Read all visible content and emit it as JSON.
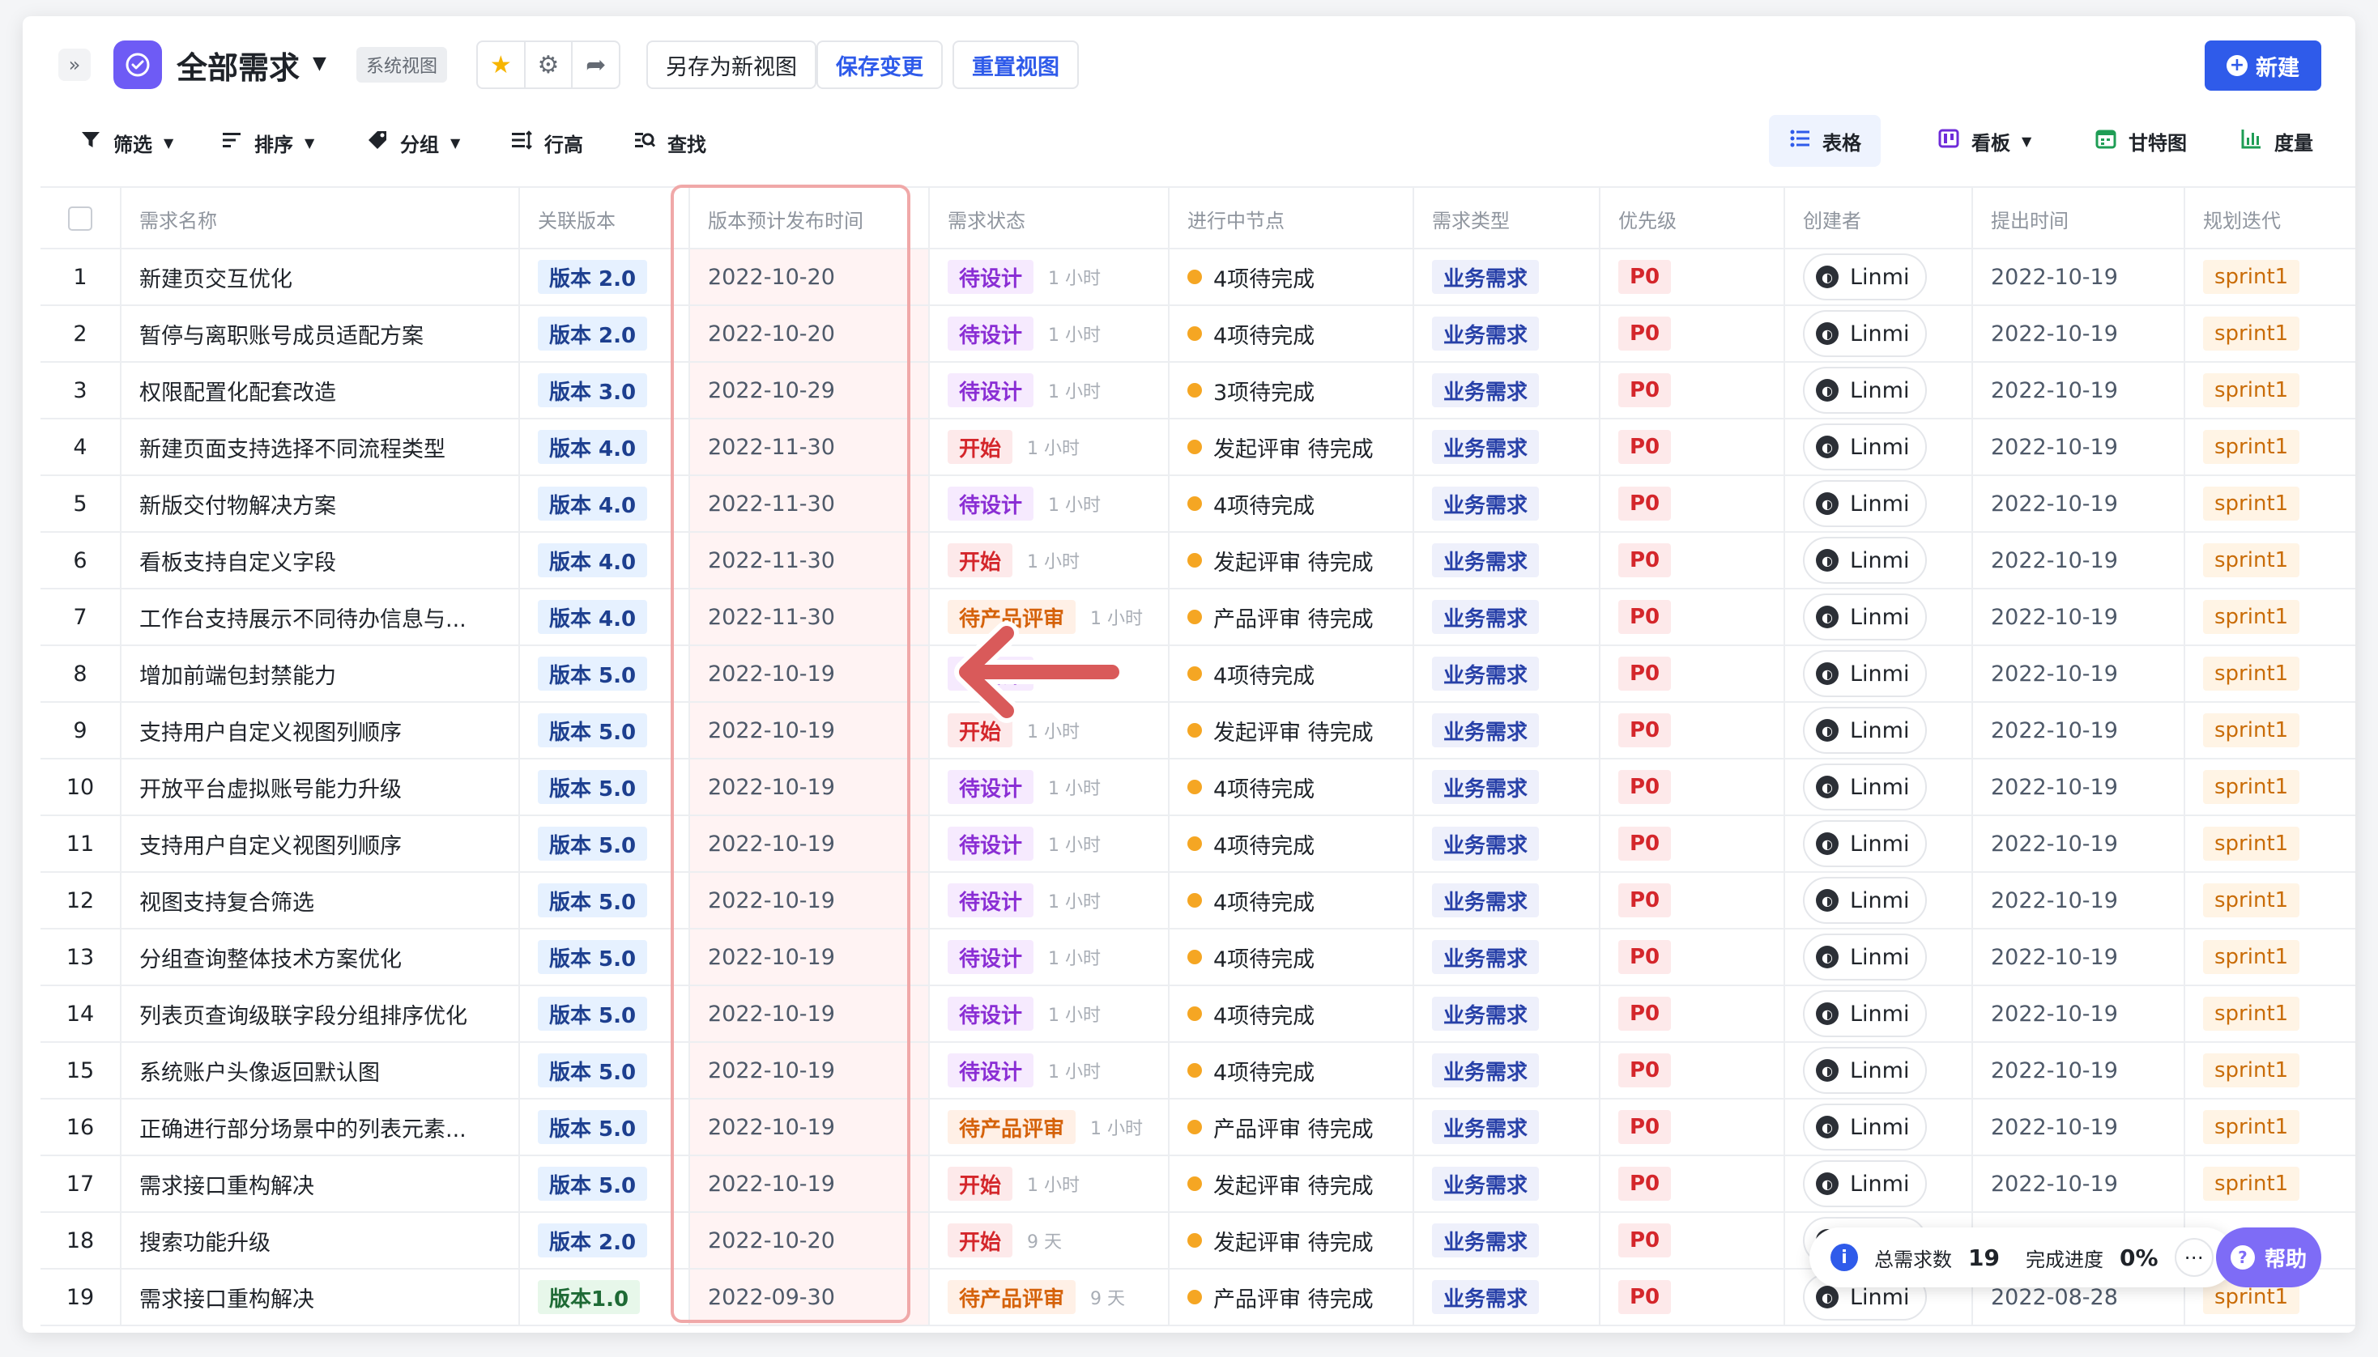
{
  "header": {
    "expand_glyph": "»",
    "title": "全部需求",
    "system_badge": "系统视图",
    "save_as_new_view": "另存为新视图",
    "save_changes": "保存变更",
    "reset_view": "重置视图",
    "new_button": "新建"
  },
  "toolbar": {
    "filter": "筛选",
    "sort": "排序",
    "group": "分组",
    "row_height": "行高",
    "find": "查找"
  },
  "views": {
    "table": "表格",
    "board": "看板",
    "gantt": "甘特图",
    "metrics": "度量"
  },
  "columns": [
    "需求名称",
    "关联版本",
    "版本预计发布时间",
    "需求状态",
    "进行中节点",
    "需求类型",
    "优先级",
    "创建者",
    "提出时间",
    "规划迭代"
  ],
  "rows": [
    {
      "no": "1",
      "name": "新建页交互优化",
      "version": "版本 2.0",
      "release": "2022-10-20",
      "status": "待设计",
      "status_kind": "design",
      "duration": "1 小时",
      "node": "4项待完成",
      "type": "业务需求",
      "priority": "P0",
      "creator": "Linmi",
      "created": "2022-10-19",
      "sprint": "sprint1"
    },
    {
      "no": "2",
      "name": "暂停与离职账号成员适配方案",
      "version": "版本 2.0",
      "release": "2022-10-20",
      "status": "待设计",
      "status_kind": "design",
      "duration": "1 小时",
      "node": "4项待完成",
      "type": "业务需求",
      "priority": "P0",
      "creator": "Linmi",
      "created": "2022-10-19",
      "sprint": "sprint1"
    },
    {
      "no": "3",
      "name": "权限配置化配套改造",
      "version": "版本 3.0",
      "release": "2022-10-29",
      "status": "待设计",
      "status_kind": "design",
      "duration": "1 小时",
      "node": "3项待完成",
      "type": "业务需求",
      "priority": "P0",
      "creator": "Linmi",
      "created": "2022-10-19",
      "sprint": "sprint1"
    },
    {
      "no": "4",
      "name": "新建页面支持选择不同流程类型",
      "version": "版本 4.0",
      "release": "2022-11-30",
      "status": "开始",
      "status_kind": "start",
      "duration": "1 小时",
      "node": "发起评审 待完成",
      "type": "业务需求",
      "priority": "P0",
      "creator": "Linmi",
      "created": "2022-10-19",
      "sprint": "sprint1"
    },
    {
      "no": "5",
      "name": "新版交付物解决方案",
      "version": "版本 4.0",
      "release": "2022-11-30",
      "status": "待设计",
      "status_kind": "design",
      "duration": "1 小时",
      "node": "4项待完成",
      "type": "业务需求",
      "priority": "P0",
      "creator": "Linmi",
      "created": "2022-10-19",
      "sprint": "sprint1"
    },
    {
      "no": "6",
      "name": "看板支持自定义字段",
      "version": "版本 4.0",
      "release": "2022-11-30",
      "status": "开始",
      "status_kind": "start",
      "duration": "1 小时",
      "node": "发起评审 待完成",
      "type": "业务需求",
      "priority": "P0",
      "creator": "Linmi",
      "created": "2022-10-19",
      "sprint": "sprint1"
    },
    {
      "no": "7",
      "name": "工作台支持展示不同待办信息与...",
      "version": "版本 4.0",
      "release": "2022-11-30",
      "status": "待产品评审",
      "status_kind": "review",
      "duration": "1 小时",
      "node": "产品评审 待完成",
      "type": "业务需求",
      "priority": "P0",
      "creator": "Linmi",
      "created": "2022-10-19",
      "sprint": "sprint1"
    },
    {
      "no": "8",
      "name": "增加前端包封禁能力",
      "version": "版本 5.0",
      "release": "2022-10-19",
      "status": "待设计",
      "status_kind": "design",
      "duration": "1 小时",
      "node": "4项待完成",
      "type": "业务需求",
      "priority": "P0",
      "creator": "Linmi",
      "created": "2022-10-19",
      "sprint": "sprint1"
    },
    {
      "no": "9",
      "name": "支持用户自定义视图列顺序",
      "version": "版本 5.0",
      "release": "2022-10-19",
      "status": "开始",
      "status_kind": "start",
      "duration": "1 小时",
      "node": "发起评审 待完成",
      "type": "业务需求",
      "priority": "P0",
      "creator": "Linmi",
      "created": "2022-10-19",
      "sprint": "sprint1"
    },
    {
      "no": "10",
      "name": "开放平台虚拟账号能力升级",
      "version": "版本 5.0",
      "release": "2022-10-19",
      "status": "待设计",
      "status_kind": "design",
      "duration": "1 小时",
      "node": "4项待完成",
      "type": "业务需求",
      "priority": "P0",
      "creator": "Linmi",
      "created": "2022-10-19",
      "sprint": "sprint1"
    },
    {
      "no": "11",
      "name": "支持用户自定义视图列顺序",
      "version": "版本 5.0",
      "release": "2022-10-19",
      "status": "待设计",
      "status_kind": "design",
      "duration": "1 小时",
      "node": "4项待完成",
      "type": "业务需求",
      "priority": "P0",
      "creator": "Linmi",
      "created": "2022-10-19",
      "sprint": "sprint1"
    },
    {
      "no": "12",
      "name": "视图支持复合筛选",
      "version": "版本 5.0",
      "release": "2022-10-19",
      "status": "待设计",
      "status_kind": "design",
      "duration": "1 小时",
      "node": "4项待完成",
      "type": "业务需求",
      "priority": "P0",
      "creator": "Linmi",
      "created": "2022-10-19",
      "sprint": "sprint1"
    },
    {
      "no": "13",
      "name": "分组查询整体技术方案优化",
      "version": "版本 5.0",
      "release": "2022-10-19",
      "status": "待设计",
      "status_kind": "design",
      "duration": "1 小时",
      "node": "4项待完成",
      "type": "业务需求",
      "priority": "P0",
      "creator": "Linmi",
      "created": "2022-10-19",
      "sprint": "sprint1"
    },
    {
      "no": "14",
      "name": "列表页查询级联字段分组排序优化",
      "version": "版本 5.0",
      "release": "2022-10-19",
      "status": "待设计",
      "status_kind": "design",
      "duration": "1 小时",
      "node": "4项待完成",
      "type": "业务需求",
      "priority": "P0",
      "creator": "Linmi",
      "created": "2022-10-19",
      "sprint": "sprint1"
    },
    {
      "no": "15",
      "name": "系统账户头像返回默认图",
      "version": "版本 5.0",
      "release": "2022-10-19",
      "status": "待设计",
      "status_kind": "design",
      "duration": "1 小时",
      "node": "4项待完成",
      "type": "业务需求",
      "priority": "P0",
      "creator": "Linmi",
      "created": "2022-10-19",
      "sprint": "sprint1"
    },
    {
      "no": "16",
      "name": "正确进行部分场景中的列表元素...",
      "version": "版本 5.0",
      "release": "2022-10-19",
      "status": "待产品评审",
      "status_kind": "review",
      "duration": "1 小时",
      "node": "产品评审 待完成",
      "type": "业务需求",
      "priority": "P0",
      "creator": "Linmi",
      "created": "2022-10-19",
      "sprint": "sprint1"
    },
    {
      "no": "17",
      "name": "需求接口重构解决",
      "version": "版本 5.0",
      "release": "2022-10-19",
      "status": "开始",
      "status_kind": "start",
      "duration": "1 小时",
      "node": "发起评审 待完成",
      "type": "业务需求",
      "priority": "P0",
      "creator": "Linmi",
      "created": "2022-10-19",
      "sprint": "sprint1"
    },
    {
      "no": "18",
      "name": "搜索功能升级",
      "version": "版本 2.0",
      "release": "2022-10-20",
      "status": "开始",
      "status_kind": "start",
      "duration": "9 天",
      "node": "发起评审 待完成",
      "type": "业务需求",
      "priority": "P0",
      "creator": "Linmi",
      "created": "",
      "sprint": ""
    },
    {
      "no": "19",
      "name": "需求接口重构解决",
      "version": "版本1.0",
      "release": "2022-09-30",
      "status": "待产品评审",
      "status_kind": "review",
      "duration": "9 天",
      "node": "产品评审 待完成",
      "type": "业务需求",
      "priority": "P0",
      "creator": "Linmi",
      "created": "2022-08-28",
      "sprint": "sprint1"
    }
  ],
  "stats": {
    "total_label": "总需求数",
    "total_value": "19",
    "progress_label": "完成进度",
    "progress_value": "0%"
  },
  "help_label": "帮助",
  "colors": {
    "brand": "#2f5bea",
    "app_icon": "#6e5bf5",
    "highlight_border": "#f0a8a8",
    "arrow": "#d95a5a"
  }
}
